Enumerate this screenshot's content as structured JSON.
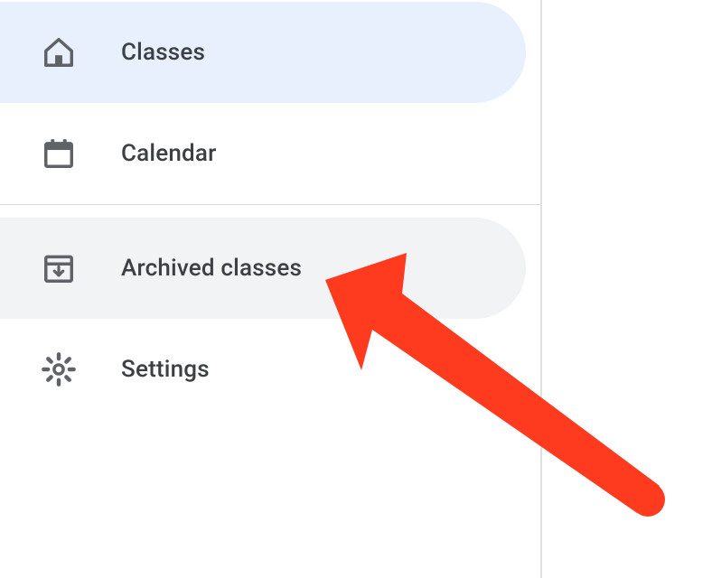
{
  "sidebar": {
    "items": [
      {
        "label": "Classes",
        "icon": "home-icon",
        "active": true
      },
      {
        "label": "Calendar",
        "icon": "calendar-icon",
        "active": false
      },
      {
        "label": "Archived classes",
        "icon": "archive-icon",
        "active": false,
        "hover": true
      },
      {
        "label": "Settings",
        "icon": "gear-icon",
        "active": false
      }
    ]
  },
  "annotation": {
    "type": "arrow",
    "color": "#ff3b1f",
    "target": "sidebar-item-archived-classes"
  }
}
